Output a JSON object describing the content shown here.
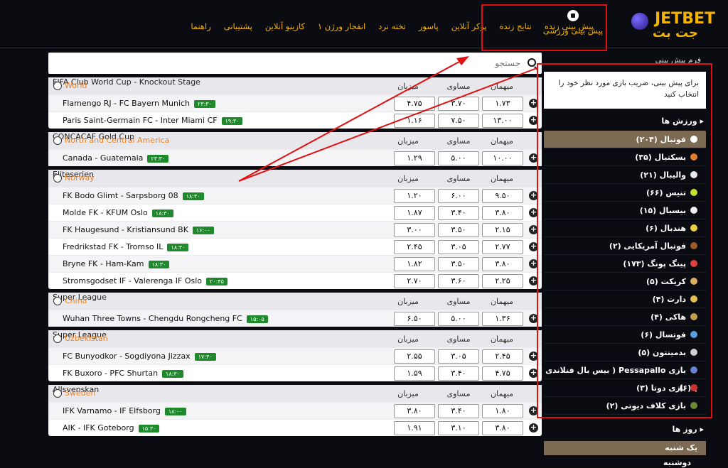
{
  "header": {
    "logo_text": "JETBET",
    "logo_sub": "جت بت",
    "sport_bet": "پیش بینی ورزشی",
    "nav": [
      "پیش بینی زنده",
      "نتایج زنده",
      "پوکر آنلاین",
      "پاسور",
      "تخته نرد",
      "انفجار ورژن ۱",
      "کازینو آنلاین",
      "پشتیبانی",
      "راهنما"
    ]
  },
  "search": {
    "placeholder": "جستجو"
  },
  "columns": {
    "home": "میزبان",
    "draw": "مساوی",
    "away": "میهمان"
  },
  "leagues": [
    {
      "country": "World",
      "name": "FIFA Club World Cup - Knockout Stage",
      "matches": [
        {
          "teams": "Flamengo RJ  -  FC Bayern Munich",
          "time": "۲۳:۳۰",
          "home": "۴.۷۵",
          "draw": "۳.۷۰",
          "away": "۱.۷۳"
        },
        {
          "teams": "Paris Saint-Germain FC  -  Inter Miami CF",
          "time": "۱۹:۳۰",
          "home": "۱.۱۶",
          "draw": "۷.۵۰",
          "away": "۱۳.۰۰"
        }
      ]
    },
    {
      "country": "North and Central America",
      "name": "CONCACAF Gold Cup",
      "matches": [
        {
          "teams": "Canada  -  Guatemala",
          "time": "۲۳:۳۰",
          "home": "۱.۲۹",
          "draw": "۵.۰۰",
          "away": "۱۰.۰۰"
        }
      ]
    },
    {
      "country": "Norway",
      "name": "Eliteserien",
      "matches": [
        {
          "teams": "FK Bodo Glimt  -  Sarpsborg 08",
          "time": "۱۸:۳۰",
          "home": "۱.۲۰",
          "draw": "۶.۰۰",
          "away": "۹.۵۰"
        },
        {
          "teams": "Molde FK  -  KFUM Oslo",
          "time": "۱۸:۳۰",
          "home": "۱.۸۷",
          "draw": "۳.۴۰",
          "away": "۳.۸۰"
        },
        {
          "teams": "FK Haugesund  -  Kristiansund BK",
          "time": "۱۶:۰۰",
          "home": "۳.۰۰",
          "draw": "۳.۵۰",
          "away": "۲.۱۵"
        },
        {
          "teams": "Fredrikstad FK  -  Tromso IL",
          "time": "۱۸:۳۰",
          "home": "۲.۴۵",
          "draw": "۳.۰۵",
          "away": "۲.۷۷"
        },
        {
          "teams": "Bryne FK  -  Ham-Kam",
          "time": "۱۸:۳۰",
          "home": "۱.۸۲",
          "draw": "۳.۵۰",
          "away": "۳.۸۰"
        },
        {
          "teams": "Stromsgodset IF  -  Valerenga IF Oslo",
          "time": "۲۰:۴۵",
          "home": "۲.۷۰",
          "draw": "۳.۶۰",
          "away": "۲.۲۵"
        }
      ]
    },
    {
      "country": "China",
      "name": "Super League",
      "matches": [
        {
          "teams": "Wuhan Three Towns  -  Chengdu Rongcheng FC",
          "time": "۱۵:۰۵",
          "home": "۶.۵۰",
          "draw": "۵.۰۰",
          "away": "۱.۳۶"
        }
      ]
    },
    {
      "country": "Uzbekistan",
      "name": "Super League",
      "matches": [
        {
          "teams": "FC Bunyodkor  -  Sogdiyona Jizzax",
          "time": "۱۷:۳۰",
          "home": "۲.۵۵",
          "draw": "۳.۰۵",
          "away": "۲.۴۵"
        },
        {
          "teams": "FK Buxoro  -  PFC Shurtan",
          "time": "۱۸:۳۰",
          "home": "۱.۵۹",
          "draw": "۳.۴۰",
          "away": "۴.۷۵"
        }
      ]
    },
    {
      "country": "Sweden",
      "name": "Allsvenskan",
      "matches": [
        {
          "teams": "IFK Varnamo  -  IF Elfsborg",
          "time": "۱۸:۰۰",
          "home": "۳.۸۰",
          "draw": "۳.۴۰",
          "away": "۱.۸۰"
        },
        {
          "teams": "AIK  -  IFK Goteborg",
          "time": "۱۵:۳۰",
          "home": "۱.۹۱",
          "draw": "۳.۱۰",
          "away": "۳.۸۰"
        }
      ]
    }
  ],
  "sidebar": {
    "form_title": "فرم پیش بینی",
    "betslip_msg": "برای پیش بینی، ضریب بازی مورد نظر خود را انتخاب کنید",
    "sports_head": "ورزش ها",
    "sports": [
      {
        "label": "فوتبال (۲۰۴)",
        "color": "#ffffff"
      },
      {
        "label": "بسکتبال (۳۵)",
        "color": "#e0802a"
      },
      {
        "label": "والیبال (۲۱)",
        "color": "#e8e8e8"
      },
      {
        "label": "تنیس (۶۶)",
        "color": "#c8e02a"
      },
      {
        "label": "بیسبال (۱۵)",
        "color": "#f0f0f0"
      },
      {
        "label": "هندبال (۶)",
        "color": "#e8d040"
      },
      {
        "label": "فوتبال آمریکایی (۲)",
        "color": "#9a5a2a"
      },
      {
        "label": "پینگ پونگ (۱۷۳)",
        "color": "#e04040"
      },
      {
        "label": "کریکت (۵)",
        "color": "#d8b060"
      },
      {
        "label": "دارت (۴)",
        "color": "#e0c050"
      },
      {
        "label": "هاکی (۴)",
        "color": "#c0a050"
      },
      {
        "label": "فوتسال (۶)",
        "color": "#5aa0e0"
      },
      {
        "label": "بدمینتون (۵)",
        "color": "#d0d0d0"
      },
      {
        "label": "بازی Pessapallo ( بیس بال فنلاندی ) (۶)",
        "color": "#6a80d0"
      },
      {
        "label": "بازی دوتا (۳)",
        "color": "#d03030"
      },
      {
        "label": "بازی کلاف دیوتی (۲)",
        "color": "#6a8a3a"
      }
    ],
    "days_head": "روز ها",
    "day_active": "یک شنبه",
    "day_next": "دوشنبه"
  }
}
